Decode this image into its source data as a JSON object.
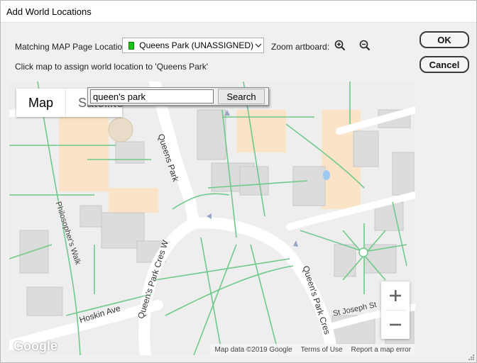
{
  "window": {
    "title": "Add World Locations"
  },
  "location": {
    "matching_label": "Matching MAP Page Location:",
    "selected_value": "Queens Park (UNASSIGNED)",
    "swatch_color": "#19c413",
    "zoom_label": "Zoom artboard:",
    "hint": "Click map to assign world location to 'Queens Park'"
  },
  "buttons": {
    "ok": "OK",
    "cancel": "Cancel"
  },
  "map": {
    "tabs": {
      "map": "Map",
      "satellite": "Satellite"
    },
    "search": {
      "value": "queen's park",
      "button": "Search"
    },
    "zoom_in": "+",
    "zoom_out": "−",
    "streets": {
      "queens_park": "Queens Park",
      "philosophers_walk": "Philosopher's Walk",
      "queens_park_cres_w": "Queen's Park Cres W",
      "queens_park_cres_e": "Queen's Park Cres",
      "hoskin_ave": "Hoskin Ave",
      "st_joseph_st": "St Joseph St"
    },
    "attribution": {
      "logo": "Google",
      "map_data": "Map data ©2019 Google",
      "terms": "Terms of Use",
      "report": "Report a map error"
    },
    "colors": {
      "background": "#eeeeee",
      "road": "#ffffff",
      "path": "#6fc98a",
      "building": "#d9d9d9",
      "highlight": "#fbe3c8"
    }
  }
}
